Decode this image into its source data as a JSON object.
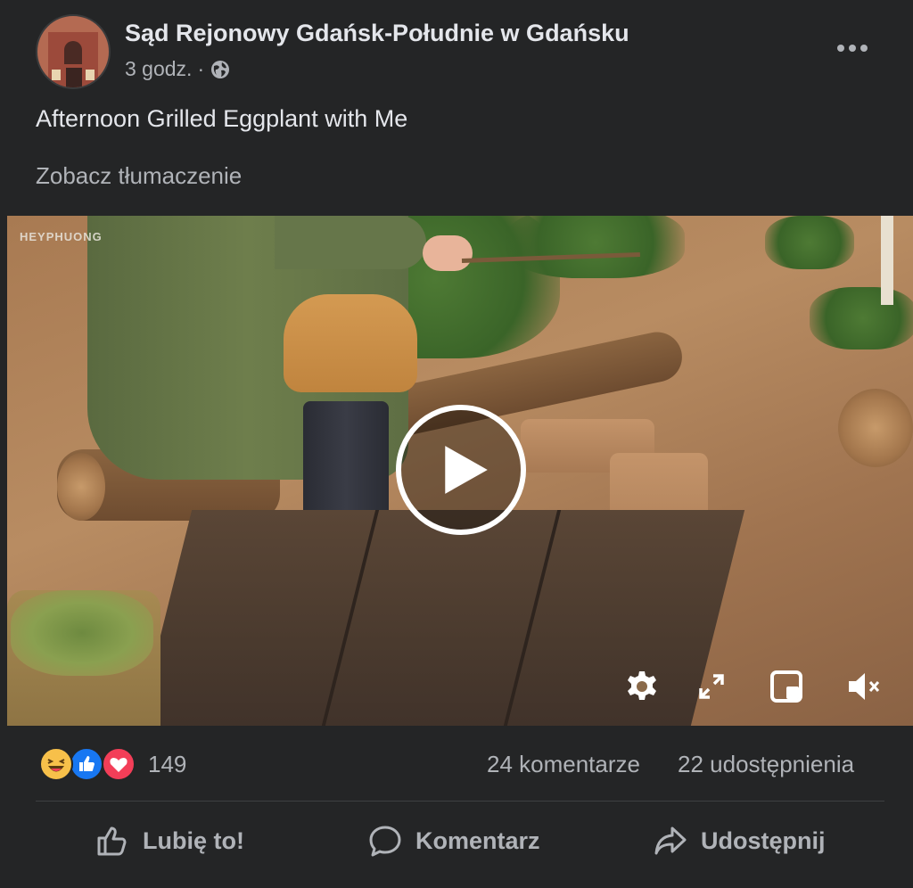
{
  "post": {
    "page_name": "Sąd Rejonowy Gdańsk-Południe w Gdańsku",
    "time": "3 godz.",
    "separator": "·",
    "audience_icon": "globe-icon",
    "more_icon": "more-options-icon",
    "text": "Afternoon Grilled Eggplant with Me",
    "see_translation": "Zobacz tłumaczenie"
  },
  "video": {
    "watermark": "HEYPHUONG",
    "controls": [
      "settings-icon",
      "fullscreen-icon",
      "picture-in-picture-icon",
      "muted-volume-icon"
    ],
    "play_icon": "play-icon"
  },
  "stats": {
    "reaction_icons": [
      "haha-reaction-icon",
      "like-reaction-icon",
      "love-reaction-icon"
    ],
    "reaction_count": "149",
    "comments": "24 komentarze",
    "shares": "22 udostępnienia"
  },
  "actions": {
    "like": "Lubię to!",
    "comment": "Komentarz",
    "share": "Udostępnij"
  },
  "colors": {
    "background": "#242526",
    "primary_text": "#e4e6eb",
    "secondary_text": "#b0b3b8",
    "like_blue": "#1877f2",
    "love_red": "#f33e58",
    "haha_yellow": "#f7c04a"
  }
}
